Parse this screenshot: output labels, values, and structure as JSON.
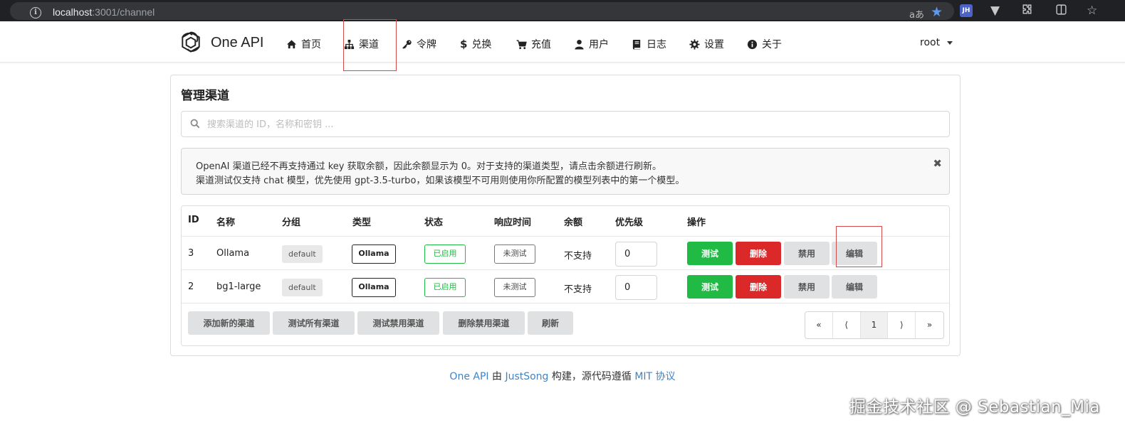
{
  "browser": {
    "url_host": "localhost",
    "url_path": ":3001/channel"
  },
  "header": {
    "brand": "One API",
    "nav": [
      {
        "label": "首页",
        "icon": "home-icon"
      },
      {
        "label": "渠道",
        "icon": "sitemap-icon"
      },
      {
        "label": "令牌",
        "icon": "key-icon"
      },
      {
        "label": "兑换",
        "icon": "dollar-icon"
      },
      {
        "label": "充值",
        "icon": "cart-icon"
      },
      {
        "label": "用户",
        "icon": "user-icon"
      },
      {
        "label": "日志",
        "icon": "book-icon"
      },
      {
        "label": "设置",
        "icon": "gear-icon"
      },
      {
        "label": "关于",
        "icon": "info-icon"
      }
    ],
    "user": "root"
  },
  "main": {
    "title": "管理渠道",
    "search_placeholder": "搜索渠道的 ID，名称和密钥 ...",
    "notice": {
      "line1": "OpenAI 渠道已经不再支持通过 key 获取余额，因此余额显示为 0。对于支持的渠道类型，请点击余额进行刷新。",
      "line2": "渠道测试仅支持 chat 模型，优先使用 gpt-3.5-turbo，如果该模型不可用则使用你所配置的模型列表中的第一个模型。"
    },
    "table": {
      "headers": [
        "ID",
        "名称",
        "分组",
        "类型",
        "状态",
        "响应时间",
        "余额",
        "优先级",
        "操作"
      ],
      "rows": [
        {
          "id": "3",
          "name": "Ollama",
          "group": "default",
          "type": "Ollama",
          "status": "已启用",
          "response": "未测试",
          "balance": "不支持",
          "priority": "0"
        },
        {
          "id": "2",
          "name": "bg1-large",
          "group": "default",
          "type": "Ollama",
          "status": "已启用",
          "response": "未测试",
          "balance": "不支持",
          "priority": "0"
        }
      ],
      "actions": {
        "test": "测试",
        "delete": "删除",
        "disable": "禁用",
        "edit": "编辑"
      }
    },
    "footer_buttons": [
      "添加新的渠道",
      "测试所有渠道",
      "测试禁用渠道",
      "删除禁用渠道",
      "刷新"
    ],
    "pager": [
      "«",
      "⟨",
      "1",
      "⟩",
      "»"
    ]
  },
  "footer": {
    "brand": "One API",
    "by": " 由 ",
    "author": "JustSong",
    "built": " 构建，源代码遵循 ",
    "license": "MIT 协议"
  },
  "watermark": "掘金技术社区 @ Sebastian_Mia",
  "colors": {
    "green": "#21ba45",
    "red": "#db2828",
    "grey": "#e0e1e2",
    "link": "#4183c4",
    "highlight": "#d84a4a"
  }
}
